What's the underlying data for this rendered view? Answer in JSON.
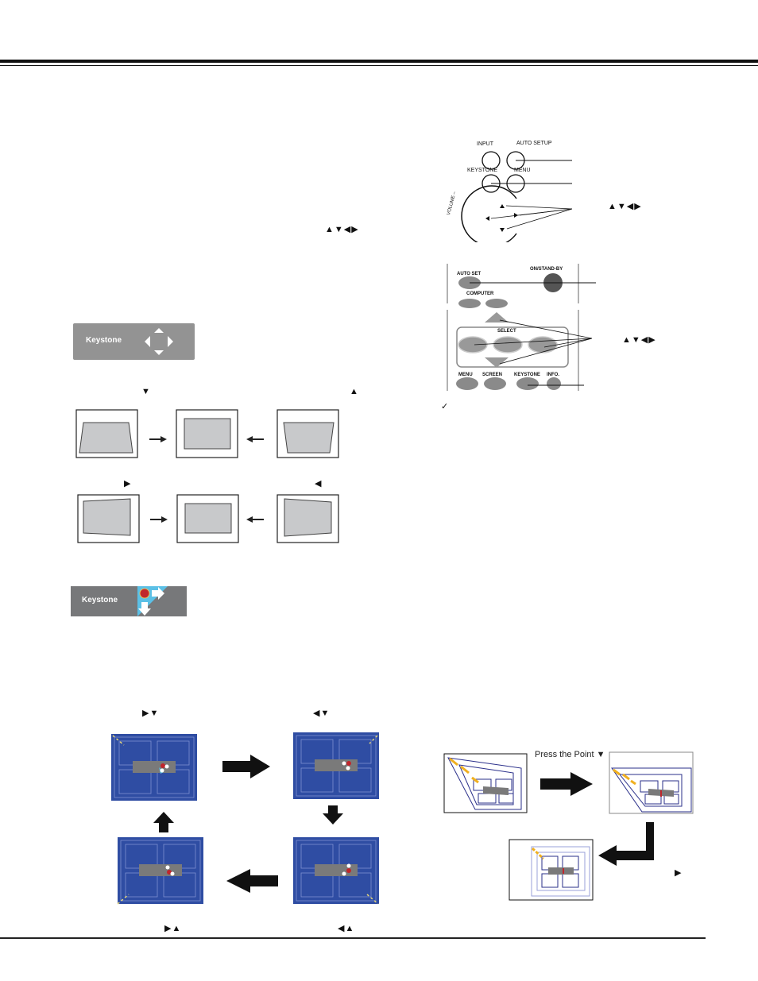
{
  "page": {
    "header_rules": "double",
    "footer_rule": "single"
  },
  "left_column": {
    "arrow_keys_glyph": "▲▼◀▶",
    "osd_keystone": {
      "label": "Keystone",
      "icon": "four-direction-arrows-icon"
    },
    "vertical_row_labels": {
      "left": "▼",
      "right": "▲"
    },
    "horizontal_row_labels": {
      "left": "▶",
      "right": "◀"
    },
    "osd_corner_keystone": {
      "label": "Keystone",
      "icon": "corner-point-arrows-icon",
      "accent_color": "#5bc0e6",
      "point_color": "#c0262c"
    },
    "corner_cycle": {
      "top_left_label": "▶▼",
      "top_right_label": "◀▼",
      "bottom_left_label": "▶▲",
      "bottom_right_label": "◀▲",
      "screen_color": "#2f4da3",
      "bar_color": "#7a7a7a"
    }
  },
  "right_column": {
    "top_control": {
      "buttons": [
        {
          "label": "INPUT"
        },
        {
          "label": "AUTO SETUP"
        },
        {
          "label": "KEYSTONE"
        },
        {
          "label": "MENU"
        }
      ],
      "ring_label": "VOLUME –",
      "arrow_keys_glyph": "▲▼◀▶"
    },
    "remote": {
      "buttons": [
        {
          "label": "AUTO SET"
        },
        {
          "label": "ON/STAND-BY"
        },
        {
          "label": "COMPUTER"
        },
        {
          "label": "SELECT"
        },
        {
          "label": "MENU"
        },
        {
          "label": "SCREEN"
        },
        {
          "label": "KEYSTONE"
        },
        {
          "label": "INFO."
        }
      ],
      "arrow_keys_glyph": "▲▼◀▶"
    },
    "note_check": "✓",
    "point_example": {
      "press_label": "Press the Point ▼",
      "next_glyph": "▶"
    }
  }
}
